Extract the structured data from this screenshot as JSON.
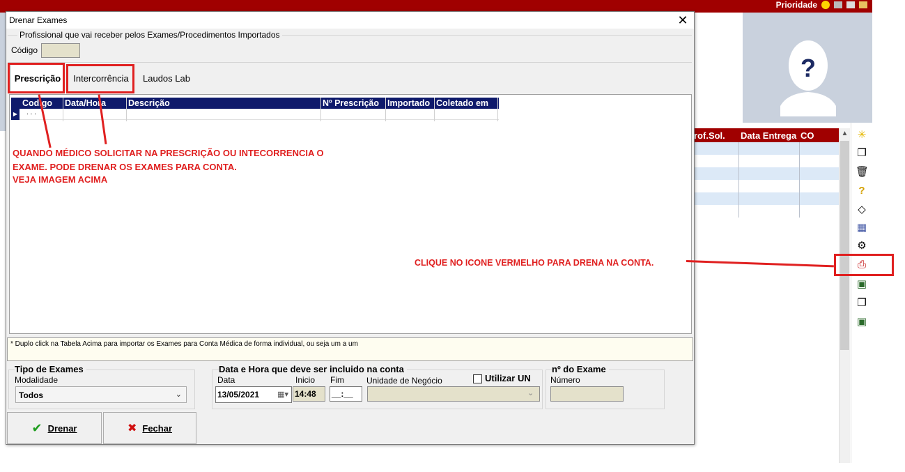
{
  "background": {
    "top_right_label": "Prioridade",
    "table_headers": [
      "rof.Sol.",
      "Data Entrega",
      "CO"
    ],
    "row_colors": [
      "#dce9f7",
      "#ffffff",
      "#dce9f7",
      "#ffffff",
      "#dce9f7",
      "#ffffff"
    ],
    "toolbar_icons": [
      "new-icon",
      "copy-icon",
      "trash-icon",
      "help-icon",
      "eraser-icon",
      "calendar-icon",
      "user-settings-icon",
      "print-red-icon",
      "monitor-icon",
      "documents-icon",
      "monitor-icon-2"
    ]
  },
  "dialog": {
    "title": "Drenar Exames",
    "professional_group": "Profissional  que vai receber pelos Exames/Procedimentos Importados",
    "codigo_label": "Código",
    "codigo_value": "",
    "tabs": [
      {
        "label": "Prescrição",
        "active": true
      },
      {
        "label": "Intercorrência",
        "active": false
      },
      {
        "label": "Laudos Lab",
        "active": false
      }
    ],
    "grid": {
      "columns": [
        "Codigo",
        "Data/Hora",
        "Descrição",
        "Nº Prescrição",
        "Importado",
        "Coletado em"
      ],
      "row_indicator": "▶",
      "row_placeholder": ". . ."
    },
    "info_text": "* Duplo click na Tabela Acima para importar os Exames para Conta Médica de forma individual, ou seja um a um",
    "tipo_exames": {
      "title": "Tipo de Exames",
      "modalidade_label": "Modalidade",
      "modalidade_value": "Todos"
    },
    "data_hora": {
      "title": "Data e Hora que deve ser incluido na conta",
      "data_label": "Data",
      "data_value": "13/05/2021",
      "inicio_label": "Inicio",
      "inicio_value": "14:48",
      "fim_label": "Fim",
      "fim_value": "__:__",
      "unidade_label": "Unidade de Negócio",
      "unidade_value": "",
      "utilizar_un_label": "Utilizar UN",
      "utilizar_un_checked": false
    },
    "numero_exame": {
      "title": "nº do Exame",
      "numero_label": "Número",
      "numero_value": ""
    },
    "buttons": {
      "drenar": "Drenar",
      "fechar": "Fechar"
    }
  },
  "annotations": {
    "note_lines": [
      "QUANDO MÉDICO SOLICITAR NA PRESCRIÇÃO OU INTECORRENCIA O",
      "EXAME. PODE DRENAR OS EXAMES PARA CONTA.",
      "VEJA IMAGEM ACIMA"
    ],
    "click_note": "CLIQUE NO ICONE VERMELHO PARA DRENA NA CONTA.",
    "color": "#e02020"
  }
}
